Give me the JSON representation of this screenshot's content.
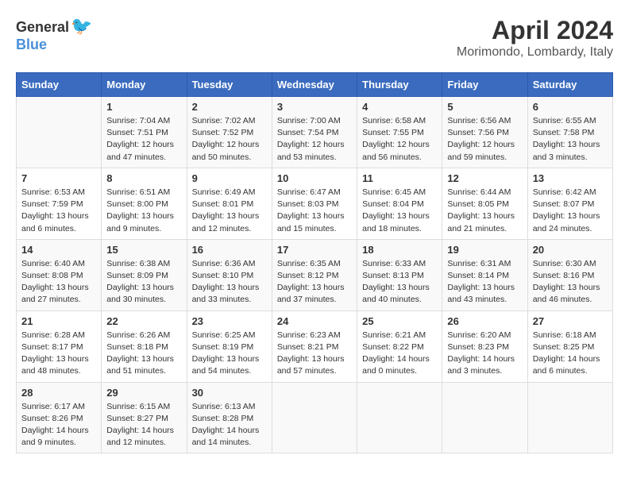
{
  "logo": {
    "general": "General",
    "blue": "Blue"
  },
  "header": {
    "month": "April 2024",
    "location": "Morimondo, Lombardy, Italy"
  },
  "weekdays": [
    "Sunday",
    "Monday",
    "Tuesday",
    "Wednesday",
    "Thursday",
    "Friday",
    "Saturday"
  ],
  "weeks": [
    [
      {
        "day": "",
        "info": ""
      },
      {
        "day": "1",
        "info": "Sunrise: 7:04 AM\nSunset: 7:51 PM\nDaylight: 12 hours\nand 47 minutes."
      },
      {
        "day": "2",
        "info": "Sunrise: 7:02 AM\nSunset: 7:52 PM\nDaylight: 12 hours\nand 50 minutes."
      },
      {
        "day": "3",
        "info": "Sunrise: 7:00 AM\nSunset: 7:54 PM\nDaylight: 12 hours\nand 53 minutes."
      },
      {
        "day": "4",
        "info": "Sunrise: 6:58 AM\nSunset: 7:55 PM\nDaylight: 12 hours\nand 56 minutes."
      },
      {
        "day": "5",
        "info": "Sunrise: 6:56 AM\nSunset: 7:56 PM\nDaylight: 12 hours\nand 59 minutes."
      },
      {
        "day": "6",
        "info": "Sunrise: 6:55 AM\nSunset: 7:58 PM\nDaylight: 13 hours\nand 3 minutes."
      }
    ],
    [
      {
        "day": "7",
        "info": "Sunrise: 6:53 AM\nSunset: 7:59 PM\nDaylight: 13 hours\nand 6 minutes."
      },
      {
        "day": "8",
        "info": "Sunrise: 6:51 AM\nSunset: 8:00 PM\nDaylight: 13 hours\nand 9 minutes."
      },
      {
        "day": "9",
        "info": "Sunrise: 6:49 AM\nSunset: 8:01 PM\nDaylight: 13 hours\nand 12 minutes."
      },
      {
        "day": "10",
        "info": "Sunrise: 6:47 AM\nSunset: 8:03 PM\nDaylight: 13 hours\nand 15 minutes."
      },
      {
        "day": "11",
        "info": "Sunrise: 6:45 AM\nSunset: 8:04 PM\nDaylight: 13 hours\nand 18 minutes."
      },
      {
        "day": "12",
        "info": "Sunrise: 6:44 AM\nSunset: 8:05 PM\nDaylight: 13 hours\nand 21 minutes."
      },
      {
        "day": "13",
        "info": "Sunrise: 6:42 AM\nSunset: 8:07 PM\nDaylight: 13 hours\nand 24 minutes."
      }
    ],
    [
      {
        "day": "14",
        "info": "Sunrise: 6:40 AM\nSunset: 8:08 PM\nDaylight: 13 hours\nand 27 minutes."
      },
      {
        "day": "15",
        "info": "Sunrise: 6:38 AM\nSunset: 8:09 PM\nDaylight: 13 hours\nand 30 minutes."
      },
      {
        "day": "16",
        "info": "Sunrise: 6:36 AM\nSunset: 8:10 PM\nDaylight: 13 hours\nand 33 minutes."
      },
      {
        "day": "17",
        "info": "Sunrise: 6:35 AM\nSunset: 8:12 PM\nDaylight: 13 hours\nand 37 minutes."
      },
      {
        "day": "18",
        "info": "Sunrise: 6:33 AM\nSunset: 8:13 PM\nDaylight: 13 hours\nand 40 minutes."
      },
      {
        "day": "19",
        "info": "Sunrise: 6:31 AM\nSunset: 8:14 PM\nDaylight: 13 hours\nand 43 minutes."
      },
      {
        "day": "20",
        "info": "Sunrise: 6:30 AM\nSunset: 8:16 PM\nDaylight: 13 hours\nand 46 minutes."
      }
    ],
    [
      {
        "day": "21",
        "info": "Sunrise: 6:28 AM\nSunset: 8:17 PM\nDaylight: 13 hours\nand 48 minutes."
      },
      {
        "day": "22",
        "info": "Sunrise: 6:26 AM\nSunset: 8:18 PM\nDaylight: 13 hours\nand 51 minutes."
      },
      {
        "day": "23",
        "info": "Sunrise: 6:25 AM\nSunset: 8:19 PM\nDaylight: 13 hours\nand 54 minutes."
      },
      {
        "day": "24",
        "info": "Sunrise: 6:23 AM\nSunset: 8:21 PM\nDaylight: 13 hours\nand 57 minutes."
      },
      {
        "day": "25",
        "info": "Sunrise: 6:21 AM\nSunset: 8:22 PM\nDaylight: 14 hours\nand 0 minutes."
      },
      {
        "day": "26",
        "info": "Sunrise: 6:20 AM\nSunset: 8:23 PM\nDaylight: 14 hours\nand 3 minutes."
      },
      {
        "day": "27",
        "info": "Sunrise: 6:18 AM\nSunset: 8:25 PM\nDaylight: 14 hours\nand 6 minutes."
      }
    ],
    [
      {
        "day": "28",
        "info": "Sunrise: 6:17 AM\nSunset: 8:26 PM\nDaylight: 14 hours\nand 9 minutes."
      },
      {
        "day": "29",
        "info": "Sunrise: 6:15 AM\nSunset: 8:27 PM\nDaylight: 14 hours\nand 12 minutes."
      },
      {
        "day": "30",
        "info": "Sunrise: 6:13 AM\nSunset: 8:28 PM\nDaylight: 14 hours\nand 14 minutes."
      },
      {
        "day": "",
        "info": ""
      },
      {
        "day": "",
        "info": ""
      },
      {
        "day": "",
        "info": ""
      },
      {
        "day": "",
        "info": ""
      }
    ]
  ]
}
